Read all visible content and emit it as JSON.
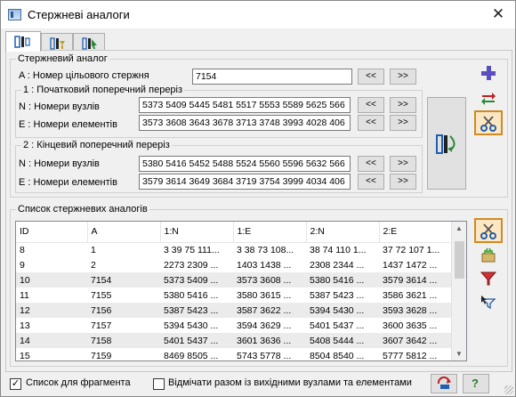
{
  "window": {
    "title": "Стержневі аналоги",
    "close_symbol": "✕"
  },
  "tabs": [
    {
      "icon": "rod-analog-tab-icon"
    },
    {
      "icon": "rod-filter-tab-icon"
    },
    {
      "icon": "rod-select-tab-icon"
    }
  ],
  "analog_group": {
    "legend": "Стержневий аналог",
    "target_label": "A :  Номер цільового стержня",
    "target_value": "7154",
    "prev": "<<",
    "next": ">>",
    "start_section": {
      "legend": "1 :  Початковий поперечний переріз",
      "nodes_label": "N :  Номери вузлів",
      "nodes_value": "5373 5409 5445 5481 5517 5553 5589 5625 566",
      "elements_label": "E :  Номери елементів",
      "elements_value": "3573 3608 3643 3678 3713 3748 3993 4028 406"
    },
    "end_section": {
      "legend": "2 :  Кінцевий поперечний переріз",
      "nodes_label": "N :  Номери вузлів",
      "nodes_value": "5380 5416 5452 5488 5524 5560 5596 5632 566",
      "elements_label": "E :  Номери елементів",
      "elements_value": "3579 3614 3649 3684 3719 3754 3999 4034 406"
    }
  },
  "list_group": {
    "legend": "Список стержневих аналогів",
    "columns": [
      "ID",
      "A",
      "1:N",
      "1:E",
      "2:N",
      "2:E"
    ],
    "rows": [
      [
        "8",
        "1",
        "3 39 75 111...",
        "3 38 73 108...",
        "38 74 110 1...",
        "37 72 107 1..."
      ],
      [
        "9",
        "2",
        "2273 2309 ...",
        "1403 1438 ...",
        "2308 2344 ...",
        "1437 1472 ..."
      ],
      [
        "10",
        "7154",
        "5373 5409 ...",
        "3573 3608 ...",
        "5380 5416 ...",
        "3579 3614 ..."
      ],
      [
        "11",
        "7155",
        "5380 5416 ...",
        "3580 3615 ...",
        "5387 5423 ...",
        "3586 3621 ..."
      ],
      [
        "12",
        "7156",
        "5387 5423 ...",
        "3587 3622 ...",
        "5394 5430 ...",
        "3593 3628 ..."
      ],
      [
        "13",
        "7157",
        "5394 5430 ...",
        "3594 3629 ...",
        "5401 5437 ...",
        "3600 3635 ..."
      ],
      [
        "14",
        "7158",
        "5401 5437 ...",
        "3601 3636 ...",
        "5408 5444 ...",
        "3607 3642 ..."
      ],
      [
        "15",
        "7159",
        "8469 8505 ...",
        "5743 5778 ...",
        "8504 8540 ...",
        "5777 5812 ..."
      ]
    ]
  },
  "bottom": {
    "fragment_checkbox_label": "Список для фрагмента",
    "fragment_checked_mark": "✓",
    "mark_checkbox_label": "Відмічати разом із вихідними вузлами та елементами",
    "help_label": "?"
  }
}
